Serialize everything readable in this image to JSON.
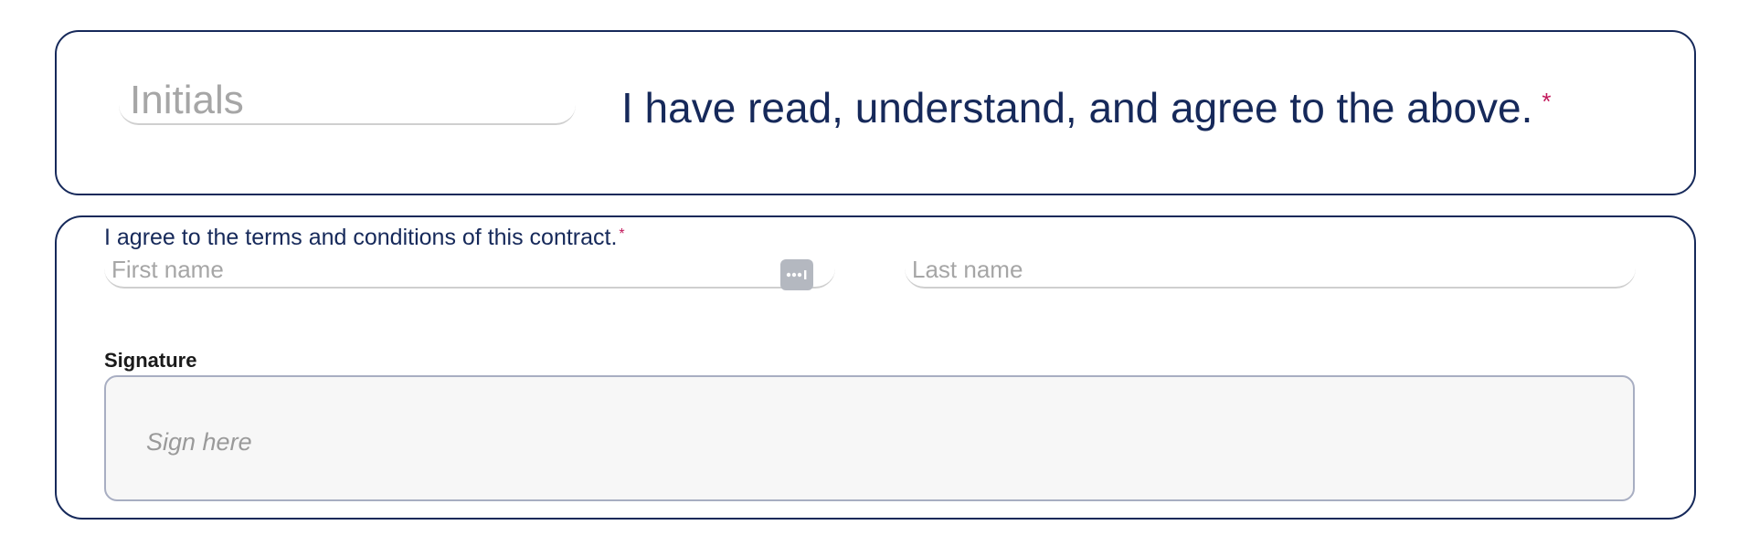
{
  "initials_section": {
    "initials_placeholder": "Initials",
    "initials_value": "",
    "agree_text": "I have read, understand, and agree to the above.",
    "required_marker": "*"
  },
  "contract_section": {
    "terms_label": "I agree to the terms and conditions of this contract.",
    "required_marker": "*",
    "first_name_placeholder": "First name",
    "first_name_value": "",
    "first_name_action_icon": "more-dots-icon",
    "last_name_placeholder": "Last name",
    "last_name_value": "",
    "signature_label": "Signature",
    "signature_placeholder": "Sign here"
  },
  "colors": {
    "border": "#16295a",
    "text_primary": "#16295a",
    "required": "#c2185b",
    "placeholder": "#a6a6a6",
    "signature_background": "#f7f7f7"
  }
}
